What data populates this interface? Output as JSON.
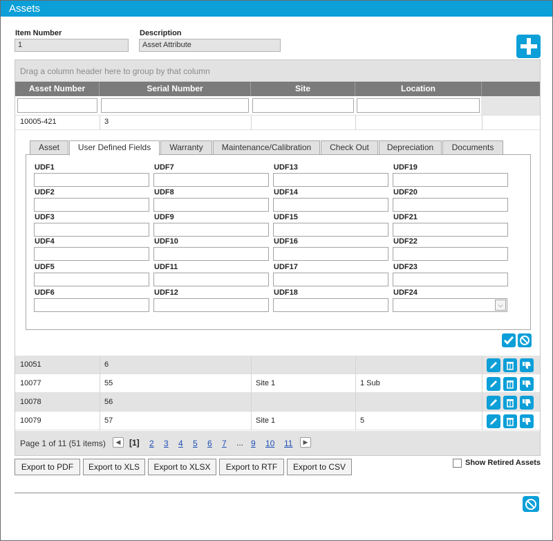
{
  "window": {
    "title": "Assets"
  },
  "header_fields": {
    "item_number_label": "Item Number",
    "item_number_value": "1",
    "description_label": "Description",
    "description_value": "Asset Attribute"
  },
  "grid": {
    "group_hint": "Drag a column header here to group by that column",
    "columns": [
      "Asset Number",
      "Serial Number",
      "Site",
      "Location"
    ],
    "expanded_row": {
      "asset_number": "10005-421",
      "serial_number": "3",
      "site": "",
      "location": ""
    },
    "rows": [
      {
        "asset_number": "10051",
        "serial_number": "6",
        "site": "",
        "location": ""
      },
      {
        "asset_number": "10077",
        "serial_number": "55",
        "site": "Site 1",
        "location": "1 Sub"
      },
      {
        "asset_number": "10078",
        "serial_number": "56",
        "site": "",
        "location": ""
      },
      {
        "asset_number": "10079",
        "serial_number": "57",
        "site": "Site 1",
        "location": "5"
      }
    ]
  },
  "detail": {
    "tabs": [
      "Asset",
      "User Defined Fields",
      "Warranty",
      "Maintenance/Calibration",
      "Check Out",
      "Depreciation",
      "Documents"
    ],
    "active_tab": "User Defined Fields",
    "udf_labels": [
      "UDF1",
      "UDF2",
      "UDF3",
      "UDF4",
      "UDF5",
      "UDF6",
      "UDF7",
      "UDF8",
      "UDF9",
      "UDF10",
      "UDF11",
      "UDF12",
      "UDF13",
      "UDF14",
      "UDF15",
      "UDF16",
      "UDF17",
      "UDF18",
      "UDF19",
      "UDF20",
      "UDF21",
      "UDF22",
      "UDF23",
      "UDF24"
    ]
  },
  "pager": {
    "info": "Page 1 of 11 (51 items)",
    "prev_icon": "chevron-left-icon",
    "next_icon": "chevron-right-icon",
    "current": "[1]",
    "pages": [
      "2",
      "3",
      "4",
      "5",
      "6",
      "7"
    ],
    "ellipsis": "...",
    "tail_pages": [
      "9",
      "10",
      "11"
    ]
  },
  "export_buttons": [
    "Export to PDF",
    "Export to XLS",
    "Export to XLSX",
    "Export to RTF",
    "Export to CSV"
  ],
  "show_retired_label": "Show Retired Assets",
  "icons": {
    "add": "plus-icon",
    "save": "check-icon",
    "cancel": "cancel-icon",
    "edit": "pencil-icon",
    "delete": "trash-icon",
    "retire": "thumbs-down-icon",
    "close": "cancel-icon"
  },
  "colors": {
    "accent": "#0c9fd8",
    "header_gray": "#7b7b7b",
    "link": "#1d4fb5"
  }
}
